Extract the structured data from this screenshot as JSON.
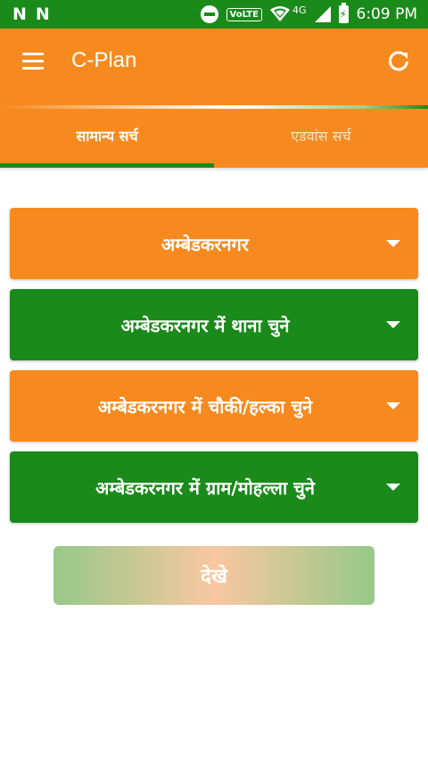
{
  "status_bar": {
    "left_icons": [
      "N",
      "N"
    ],
    "volte": "VoLTE",
    "network": "4G",
    "time": "6:09 PM"
  },
  "app_bar": {
    "title": "C-Plan"
  },
  "tabs": [
    {
      "label": "सामान्य सर्च",
      "active": true
    },
    {
      "label": "एडवांस सर्च",
      "active": false
    }
  ],
  "dropdowns": [
    {
      "label": "अम्बेडकरनगर",
      "color": "#f78a1f"
    },
    {
      "label": "अम्बेडकरनगर में थाना चुने",
      "color": "#1a8a1a"
    },
    {
      "label": "अम्बेडकरनगर में चौकी/हल्का चुने",
      "color": "#f78a1f"
    },
    {
      "label": "अम्बेडकरनगर में ग्राम/मोहल्ला चुने",
      "color": "#1a8a1a"
    }
  ],
  "view_button": {
    "label": "देखे"
  },
  "colors": {
    "primary_orange": "#f78a1f",
    "primary_green": "#1a8a1a",
    "white": "#ffffff"
  }
}
